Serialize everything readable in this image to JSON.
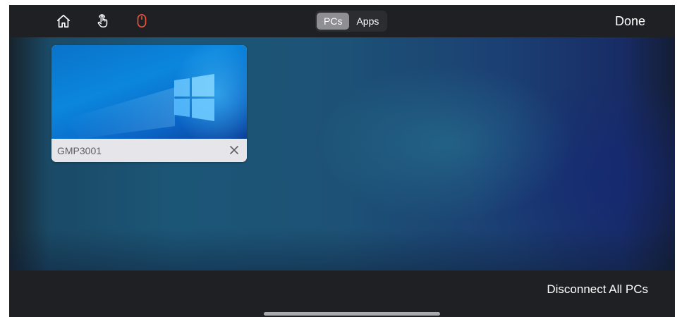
{
  "toolbar": {
    "icons": [
      "home-icon",
      "touch-icon",
      "mouse-icon"
    ],
    "mouse_icon_color": "#e8533a",
    "segments": [
      {
        "label": "PCs",
        "selected": true
      },
      {
        "label": "Apps",
        "selected": false
      }
    ],
    "done_label": "Done"
  },
  "sessions": [
    {
      "name": "GMP3001",
      "thumbnail": "windows-logo-wallpaper",
      "close_icon": "close-icon"
    }
  ],
  "footer": {
    "disconnect_label": "Disconnect All PCs"
  },
  "colors": {
    "bar_background": "#1f2023",
    "segment_active": "#8e8e93",
    "card_footer": "#e6e6ea"
  }
}
